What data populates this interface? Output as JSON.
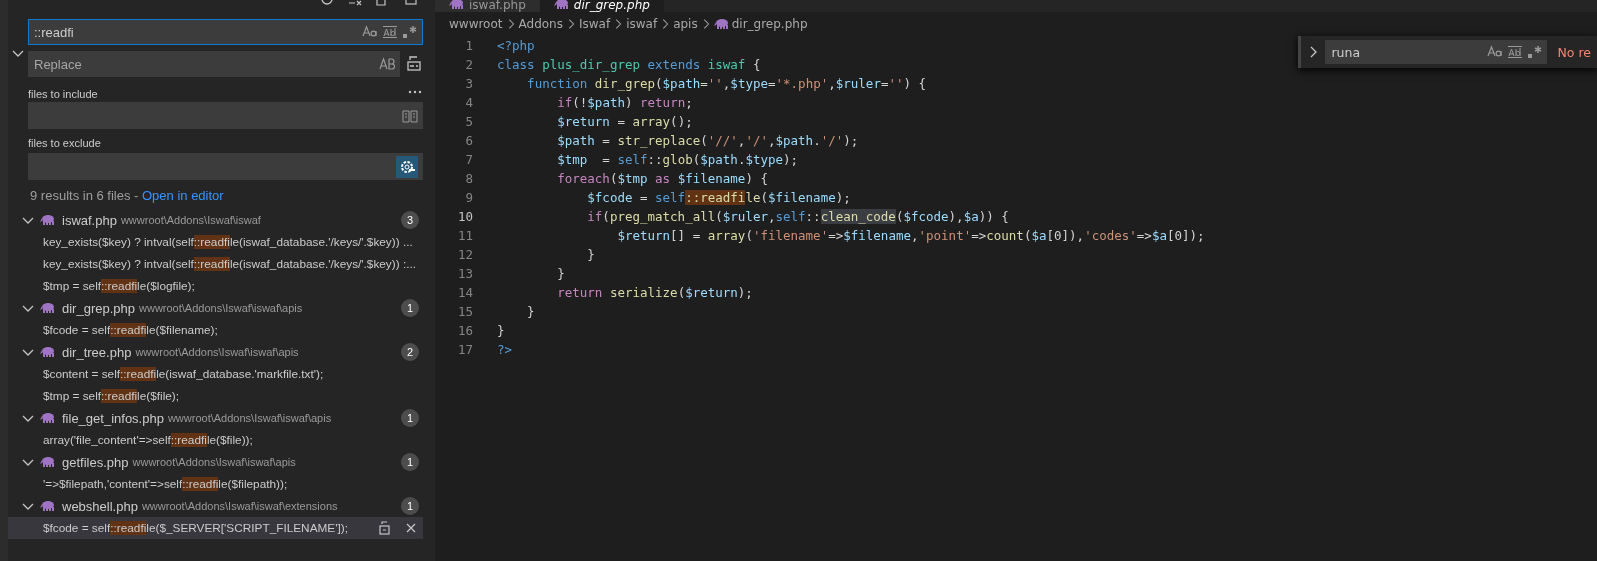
{
  "tabs": [
    {
      "label": "iswaf.php",
      "selected": false
    },
    {
      "label": "dir_grep.php",
      "selected": true
    }
  ],
  "search": {
    "query": "::readfi",
    "replace_placeholder": "Replace",
    "replace_expanded": true,
    "include_label": "files to include",
    "exclude_label": "files to exclude",
    "use_exclude_settings": true,
    "summary": "9 results in 6 files - ",
    "open_link": "Open in editor"
  },
  "results": [
    {
      "file": "iswaf.php",
      "path": "wwwroot\\Addons\\Iswaf\\iswaf",
      "count": "3",
      "expanded": true,
      "matches": [
        {
          "before": "key_exists($key) ? intval(self",
          "match": "::readfi",
          "after": "le(iswaf_database.'/keys/'.$key)) ...",
          "selected": false
        },
        {
          "before": "key_exists($key) ? intval(self",
          "match": "::readfi",
          "after": "le(iswaf_database.'/keys/'.$key)) :...",
          "selected": false
        },
        {
          "before": "$tmp = self",
          "match": "::readfi",
          "after": "le($logfile);",
          "selected": false
        }
      ]
    },
    {
      "file": "dir_grep.php",
      "path": "wwwroot\\Addons\\Iswaf\\iswaf\\apis",
      "count": "1",
      "expanded": true,
      "matches": [
        {
          "before": "$fcode = self",
          "match": "::readfi",
          "after": "le($filename);",
          "selected": false
        }
      ]
    },
    {
      "file": "dir_tree.php",
      "path": "wwwroot\\Addons\\Iswaf\\iswaf\\apis",
      "count": "2",
      "expanded": true,
      "matches": [
        {
          "before": "$content = self",
          "match": "::readfi",
          "after": "le(iswaf_database.'markfile.txt');",
          "selected": false
        },
        {
          "before": "$tmp = self",
          "match": "::readfi",
          "after": "le($file);",
          "selected": false
        }
      ]
    },
    {
      "file": "file_get_infos.php",
      "path": "wwwroot\\Addons\\Iswaf\\iswaf\\apis",
      "count": "1",
      "expanded": true,
      "matches": [
        {
          "before": "array('file_content'=>self",
          "match": "::readfi",
          "after": "le($file));",
          "selected": false
        }
      ]
    },
    {
      "file": "getfiles.php",
      "path": "wwwroot\\Addons\\Iswaf\\iswaf\\apis",
      "count": "1",
      "expanded": true,
      "matches": [
        {
          "before": "'=>$filepath,'content'=>self",
          "match": "::readfi",
          "after": "le($filepath));",
          "selected": false
        }
      ]
    },
    {
      "file": "webshell.php",
      "path": "wwwroot\\Addons\\Iswaf\\iswaf\\extensions",
      "count": "1",
      "expanded": true,
      "matches": [
        {
          "before": "$fcode = self",
          "match": "::readfi",
          "after": "le($_SERVER['SCRIPT_FILENAME']);",
          "selected": true
        }
      ]
    }
  ],
  "breadcrumb": [
    "wwwroot",
    "Addons",
    "Iswaf",
    "iswaf",
    "apis",
    "dir_grep.php"
  ],
  "code": [
    {
      "number": "1",
      "active": false,
      "tokens": [
        {
          "kind": "kw",
          "text": "<?php"
        }
      ]
    },
    {
      "number": "2",
      "active": false,
      "tokens": [
        {
          "kind": "kw",
          "text": "class "
        },
        {
          "kind": "cls",
          "text": "plus_dir_grep"
        },
        {
          "kind": "kw",
          "text": " extends "
        },
        {
          "kind": "cls",
          "text": "iswaf"
        },
        {
          "kind": "p",
          "text": " {"
        }
      ]
    },
    {
      "number": "3",
      "active": false,
      "tokens": [
        {
          "kind": "kw",
          "text": "    function "
        },
        {
          "kind": "fn",
          "text": "dir_grep"
        },
        {
          "kind": "p",
          "text": "("
        },
        {
          "kind": "var",
          "text": "$path"
        },
        {
          "kind": "p",
          "text": "="
        },
        {
          "kind": "str",
          "text": "''"
        },
        {
          "kind": "p",
          "text": ","
        },
        {
          "kind": "var",
          "text": "$type"
        },
        {
          "kind": "p",
          "text": "="
        },
        {
          "kind": "str",
          "text": "'*.php'"
        },
        {
          "kind": "p",
          "text": ","
        },
        {
          "kind": "var",
          "text": "$ruler"
        },
        {
          "kind": "p",
          "text": "="
        },
        {
          "kind": "str",
          "text": "''"
        },
        {
          "kind": "p",
          "text": ") {"
        }
      ]
    },
    {
      "number": "4",
      "active": false,
      "tokens": [
        {
          "kind": "ctl",
          "text": "        if"
        },
        {
          "kind": "p",
          "text": "(!"
        },
        {
          "kind": "var",
          "text": "$path"
        },
        {
          "kind": "p",
          "text": ") "
        },
        {
          "kind": "ctl",
          "text": "return"
        },
        {
          "kind": "p",
          "text": ";"
        }
      ]
    },
    {
      "number": "5",
      "active": false,
      "tokens": [
        {
          "kind": "var",
          "text": "        $return"
        },
        {
          "kind": "p",
          "text": " = "
        },
        {
          "kind": "fn",
          "text": "array"
        },
        {
          "kind": "p",
          "text": "();"
        }
      ]
    },
    {
      "number": "6",
      "active": false,
      "tokens": [
        {
          "kind": "var",
          "text": "        $path"
        },
        {
          "kind": "p",
          "text": " = "
        },
        {
          "kind": "fn",
          "text": "str_replace"
        },
        {
          "kind": "p",
          "text": "("
        },
        {
          "kind": "str",
          "text": "'//'"
        },
        {
          "kind": "p",
          "text": ","
        },
        {
          "kind": "str",
          "text": "'/'"
        },
        {
          "kind": "p",
          "text": ","
        },
        {
          "kind": "var",
          "text": "$path"
        },
        {
          "kind": "p",
          "text": "."
        },
        {
          "kind": "str",
          "text": "'/'"
        },
        {
          "kind": "p",
          "text": ");"
        }
      ]
    },
    {
      "number": "7",
      "active": false,
      "tokens": [
        {
          "kind": "var",
          "text": "        $tmp"
        },
        {
          "kind": "p",
          "text": "  = "
        },
        {
          "kind": "kw",
          "text": "self"
        },
        {
          "kind": "p",
          "text": "::"
        },
        {
          "kind": "fn",
          "text": "glob"
        },
        {
          "kind": "p",
          "text": "("
        },
        {
          "kind": "var",
          "text": "$path"
        },
        {
          "kind": "p",
          "text": "."
        },
        {
          "kind": "var",
          "text": "$type"
        },
        {
          "kind": "p",
          "text": ");"
        }
      ]
    },
    {
      "number": "8",
      "active": false,
      "tokens": [
        {
          "kind": "ctl",
          "text": "        foreach"
        },
        {
          "kind": "p",
          "text": "("
        },
        {
          "kind": "var",
          "text": "$tmp"
        },
        {
          "kind": "ctl",
          "text": " as "
        },
        {
          "kind": "var",
          "text": "$filename"
        },
        {
          "kind": "p",
          "text": ") {"
        }
      ]
    },
    {
      "number": "9",
      "active": false,
      "tokens": [
        {
          "kind": "var",
          "text": "            $fcode"
        },
        {
          "kind": "p",
          "text": " = "
        },
        {
          "kind": "kw",
          "text": "self"
        },
        {
          "kind": "match",
          "text": "::readfi"
        },
        {
          "kind": "fn",
          "text": "le"
        },
        {
          "kind": "p",
          "text": "("
        },
        {
          "kind": "var",
          "text": "$filename"
        },
        {
          "kind": "p",
          "text": ");"
        }
      ]
    },
    {
      "number": "10",
      "active": true,
      "tokens": [
        {
          "kind": "ctl",
          "text": "            if"
        },
        {
          "kind": "p",
          "text": "("
        },
        {
          "kind": "fn",
          "text": "preg_match_all"
        },
        {
          "kind": "p",
          "text": "("
        },
        {
          "kind": "var",
          "text": "$ruler"
        },
        {
          "kind": "p",
          "text": ","
        },
        {
          "kind": "kw",
          "text": "self"
        },
        {
          "kind": "p",
          "text": "::"
        },
        {
          "kind": "sel",
          "text": "clean_code"
        },
        {
          "kind": "p",
          "text": "("
        },
        {
          "kind": "var",
          "text": "$fcode"
        },
        {
          "kind": "p",
          "text": "),"
        },
        {
          "kind": "var",
          "text": "$a"
        },
        {
          "kind": "p",
          "text": ")) {"
        }
      ]
    },
    {
      "number": "11",
      "active": false,
      "tokens": [
        {
          "kind": "var",
          "text": "                $return"
        },
        {
          "kind": "p",
          "text": "[] = "
        },
        {
          "kind": "fn",
          "text": "array"
        },
        {
          "kind": "p",
          "text": "("
        },
        {
          "kind": "str",
          "text": "'filename'"
        },
        {
          "kind": "p",
          "text": "=>"
        },
        {
          "kind": "var",
          "text": "$filename"
        },
        {
          "kind": "p",
          "text": ","
        },
        {
          "kind": "str",
          "text": "'point'"
        },
        {
          "kind": "p",
          "text": "=>"
        },
        {
          "kind": "fn",
          "text": "count"
        },
        {
          "kind": "p",
          "text": "("
        },
        {
          "kind": "var",
          "text": "$a"
        },
        {
          "kind": "p",
          "text": "[0]),"
        },
        {
          "kind": "str",
          "text": "'codes'"
        },
        {
          "kind": "p",
          "text": "=>"
        },
        {
          "kind": "var",
          "text": "$a"
        },
        {
          "kind": "p",
          "text": "[0]);"
        }
      ]
    },
    {
      "number": "12",
      "active": false,
      "tokens": [
        {
          "kind": "p",
          "text": "            }"
        }
      ]
    },
    {
      "number": "13",
      "active": false,
      "tokens": [
        {
          "kind": "p",
          "text": "        }"
        }
      ]
    },
    {
      "number": "14",
      "active": false,
      "tokens": [
        {
          "kind": "ctl",
          "text": "        return"
        },
        {
          "kind": "fn",
          "text": " serialize"
        },
        {
          "kind": "p",
          "text": "("
        },
        {
          "kind": "var",
          "text": "$return"
        },
        {
          "kind": "p",
          "text": ");"
        }
      ]
    },
    {
      "number": "15",
      "active": false,
      "tokens": [
        {
          "kind": "p",
          "text": "    }"
        }
      ]
    },
    {
      "number": "16",
      "active": false,
      "tokens": [
        {
          "kind": "p",
          "text": "}"
        }
      ]
    },
    {
      "number": "17",
      "active": false,
      "tokens": [
        {
          "kind": "kw",
          "text": "?>"
        }
      ]
    }
  ],
  "find_widget": {
    "query": "runa",
    "replace_expanded": false,
    "status": "No re"
  }
}
